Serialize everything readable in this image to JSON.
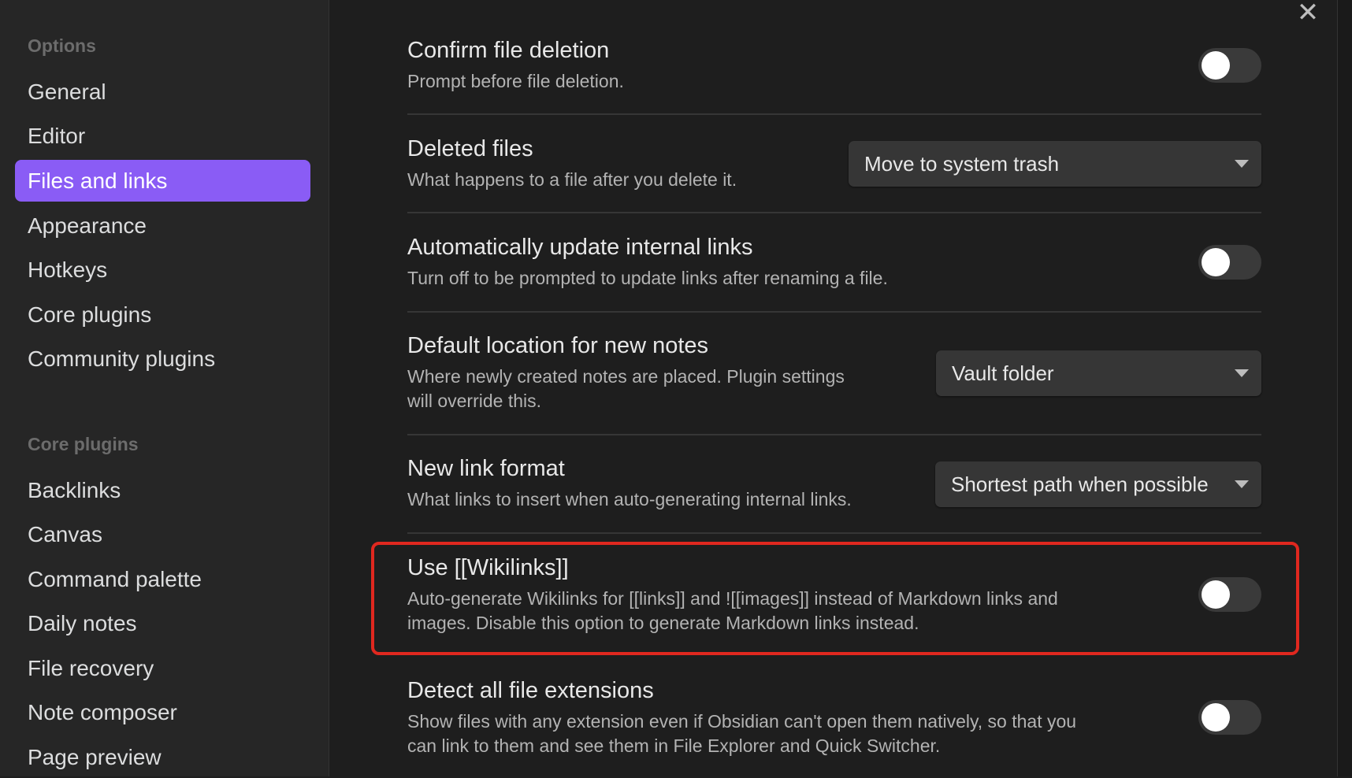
{
  "sidebar": {
    "options_heading": "Options",
    "options_items": [
      {
        "label": "General"
      },
      {
        "label": "Editor"
      },
      {
        "label": "Files and links"
      },
      {
        "label": "Appearance"
      },
      {
        "label": "Hotkeys"
      },
      {
        "label": "Core plugins"
      },
      {
        "label": "Community plugins"
      }
    ],
    "active_item": "Files and links",
    "core_heading": "Core plugins",
    "core_items": [
      {
        "label": "Backlinks"
      },
      {
        "label": "Canvas"
      },
      {
        "label": "Command palette"
      },
      {
        "label": "Daily notes"
      },
      {
        "label": "File recovery"
      },
      {
        "label": "Note composer"
      },
      {
        "label": "Page preview"
      }
    ]
  },
  "close_icon": "✕",
  "settings": {
    "confirm_deletion": {
      "title": "Confirm file deletion",
      "desc": "Prompt before file deletion.",
      "enabled": false
    },
    "deleted_files": {
      "title": "Deleted files",
      "desc": "What happens to a file after you delete it.",
      "value": "Move to system trash"
    },
    "auto_update_links": {
      "title": "Automatically update internal links",
      "desc": "Turn off to be prompted to update links after renaming a file.",
      "enabled": false
    },
    "default_location": {
      "title": "Default location for new notes",
      "desc_line1": "Where newly created notes are placed. Plugin settings",
      "desc_line2": "will override this.",
      "value": "Vault folder"
    },
    "link_format": {
      "title": "New link format",
      "desc": "What links to insert when auto-generating internal links.",
      "value": "Shortest path when possible"
    },
    "wikilinks": {
      "title": "Use [[Wikilinks]]",
      "desc_line1": "Auto-generate Wikilinks for [[links]] and ![[images]] instead of Markdown links and",
      "desc_line2": "images. Disable this option to generate Markdown links instead.",
      "enabled": false
    },
    "detect_extensions": {
      "title": "Detect all file extensions",
      "desc_line1": "Show files with any extension even if Obsidian can't open them natively, so that you",
      "desc_line2": "can link to them and see them in File Explorer and Quick Switcher.",
      "enabled": false
    }
  },
  "colors": {
    "accent": "#8a5cf5",
    "highlight_border": "#e0281f",
    "background": "#1e1e1e",
    "sidebar_bg": "#262626"
  }
}
